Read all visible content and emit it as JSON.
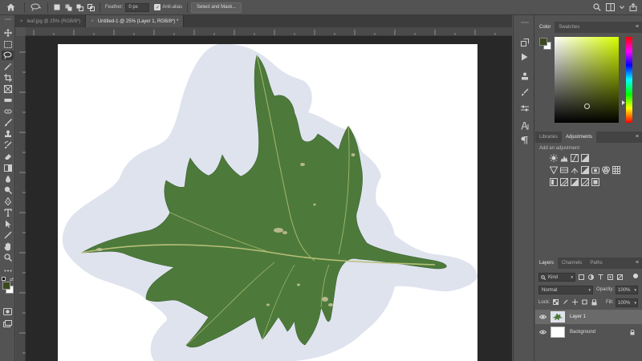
{
  "options_bar": {
    "feather_label": "Feather:",
    "feather_value": "0 px",
    "antialias_label": "Anti-alias",
    "select_mask_label": "Select and Mask..."
  },
  "tabs": [
    {
      "label": "leaf.jpg @ 25% (RGB/8*)",
      "active": false
    },
    {
      "label": "Untitled-1 @ 25% (Layer 1, RGB/8*) *",
      "active": true
    }
  ],
  "color_panel": {
    "tabs": [
      "Color",
      "Swatches"
    ],
    "foreground": "#3b4a1d",
    "background": "#ffffff",
    "hue_color": "#d8ff00"
  },
  "adjustments_panel": {
    "tabs": [
      "Libraries",
      "Adjustments"
    ],
    "hint": "Add an adjustment"
  },
  "layers_panel": {
    "tabs": [
      "Layers",
      "Channels",
      "Paths"
    ],
    "filter_label": "Kind",
    "blend_mode": "Normal",
    "opacity_label": "Opacity:",
    "opacity_value": "100%",
    "lock_label": "Lock:",
    "fill_label": "Fill:",
    "fill_value": "100%",
    "layers": [
      {
        "name": "Layer 1",
        "selected": true
      },
      {
        "name": "Background",
        "selected": false,
        "locked": true
      }
    ]
  },
  "colors": {
    "leaf": "#4d7a3a",
    "shadow": "#dfe3ee"
  }
}
